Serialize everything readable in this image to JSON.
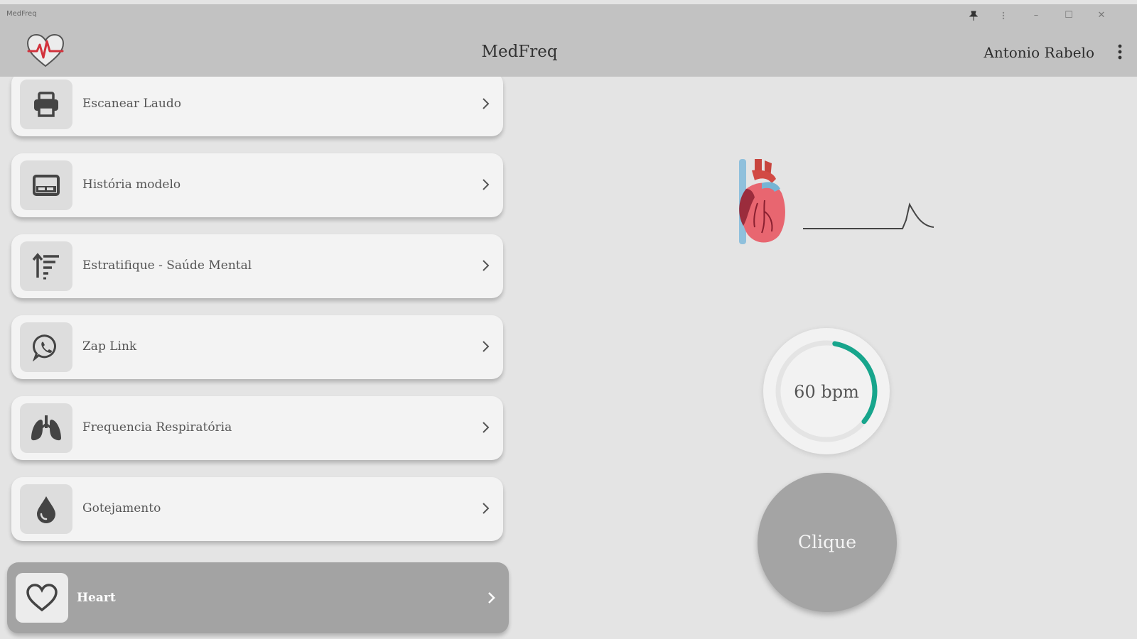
{
  "window": {
    "title": "MedFreq",
    "controls": {
      "pin": "pin-icon",
      "more": "more-icon",
      "minimize": "–",
      "maximize": "☐",
      "close": "✕"
    }
  },
  "header": {
    "logo": "heart-pulse-logo",
    "title": "MedFreq",
    "user_name": "Antonio Rabelo",
    "menu_icon": "kebab-menu-icon"
  },
  "menu": {
    "items": [
      {
        "label": "Escanear Laudo",
        "icon": "printer-icon"
      },
      {
        "label": "História modelo",
        "icon": "card-icon"
      },
      {
        "label": "Estratifique - Saúde Mental",
        "icon": "sort-icon"
      },
      {
        "label": "Zap Link",
        "icon": "whatsapp-icon"
      },
      {
        "label": "Frequencia Respiratória",
        "icon": "lungs-icon"
      },
      {
        "label": "Gotejamento",
        "icon": "drop-icon"
      },
      {
        "label": "Heart",
        "icon": "heart-outline-icon",
        "selected": true
      }
    ]
  },
  "main": {
    "illustration": "anatomical-heart-icon",
    "rate": "60 bpm",
    "rate_progress": 0.33,
    "button_label": "Clique"
  },
  "colors": {
    "accent": "#17a58c",
    "appbar": "#c2c2c2",
    "background": "#e4e4e4",
    "selected_item": "#a3a3a3",
    "logo_red": "#d2323c"
  }
}
